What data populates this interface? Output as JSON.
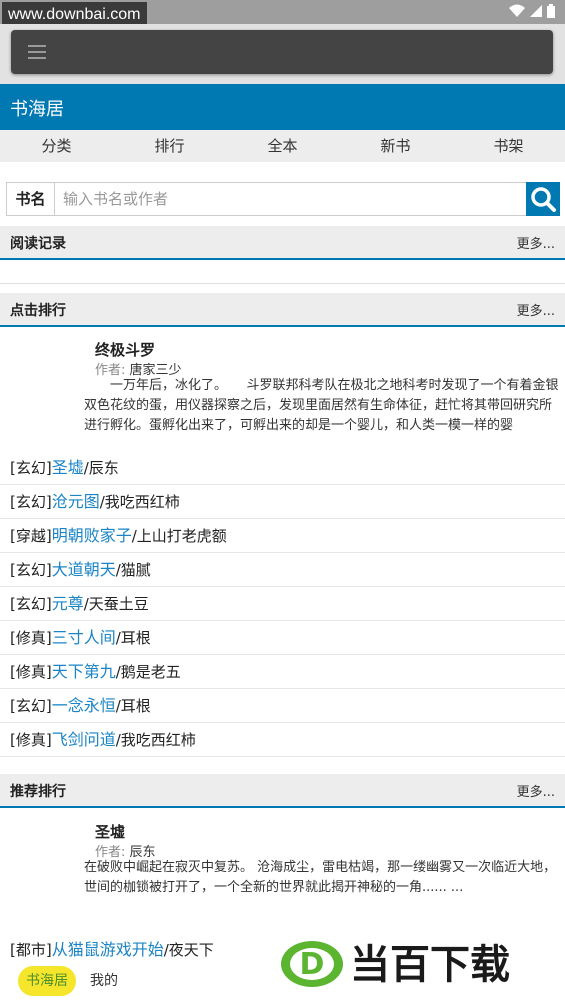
{
  "watermark": {
    "url": "www.downbai.com"
  },
  "status_icons": [
    "wifi-icon",
    "signal-icon",
    "battery-icon"
  ],
  "header": {
    "title": "书海居"
  },
  "nav": [
    "分类",
    "排行",
    "全本",
    "新书",
    "书架"
  ],
  "search": {
    "label": "书名",
    "placeholder": "输入书名或作者"
  },
  "sections": {
    "reading": {
      "title": "阅读记录",
      "more": "更多..."
    },
    "click_rank": {
      "title": "点击排行",
      "more": "更多..."
    },
    "recommend": {
      "title": "推荐排行",
      "more": "更多..."
    }
  },
  "click_feature": {
    "title": "终极斗罗",
    "author_label": "作者:",
    "author": "唐家三少",
    "desc": "　　一万年后，冰化了。　　斗罗联邦科考队在极北之地科考时发现了一个有着金银双色花纹的蛋，用仪器探察之后，发现里面居然有生命体征，赶忙将其带回研究所进行孵化。蛋孵化出来了，可孵出来的却是一个婴儿，和人类一模一样的婴"
  },
  "click_list": [
    {
      "cat": "[玄幻]",
      "name": "圣墟",
      "author": "辰东"
    },
    {
      "cat": "[玄幻]",
      "name": "沧元图",
      "author": "我吃西红柿"
    },
    {
      "cat": "[穿越]",
      "name": "明朝败家子",
      "author": "上山打老虎额"
    },
    {
      "cat": "[玄幻]",
      "name": "大道朝天",
      "author": "猫腻"
    },
    {
      "cat": "[玄幻]",
      "name": "元尊",
      "author": "天蚕土豆"
    },
    {
      "cat": "[修真]",
      "name": "三寸人间",
      "author": "耳根"
    },
    {
      "cat": "[修真]",
      "name": "天下第九",
      "author": "鹅是老五"
    },
    {
      "cat": "[玄幻]",
      "name": "一念永恒",
      "author": "耳根"
    },
    {
      "cat": "[修真]",
      "name": "飞剑问道",
      "author": "我吃西红柿"
    }
  ],
  "recommend_feature": {
    "title": "圣墟",
    "author_label": "作者:",
    "author": "辰东",
    "desc": "在破败中崛起在寂灭中复苏。 沧海成尘，雷电枯竭，那一缕幽雾又一次临近大地，世间的枷锁被打开了，一个全新的世界就此揭开神秘的一角...... ..."
  },
  "recommend_list": [
    {
      "cat": "[都市]",
      "name": "从猫鼠游戏开始",
      "author": "夜天下"
    }
  ],
  "bottom_tabs": {
    "home": "书海居",
    "mine": "我的"
  },
  "brand": {
    "text": "当百下载",
    "letter": "D"
  },
  "colors": {
    "primary": "#0078b2",
    "link": "#1a84c6",
    "active_tab": "#f5e52b",
    "brand_green": "#5cb531"
  }
}
